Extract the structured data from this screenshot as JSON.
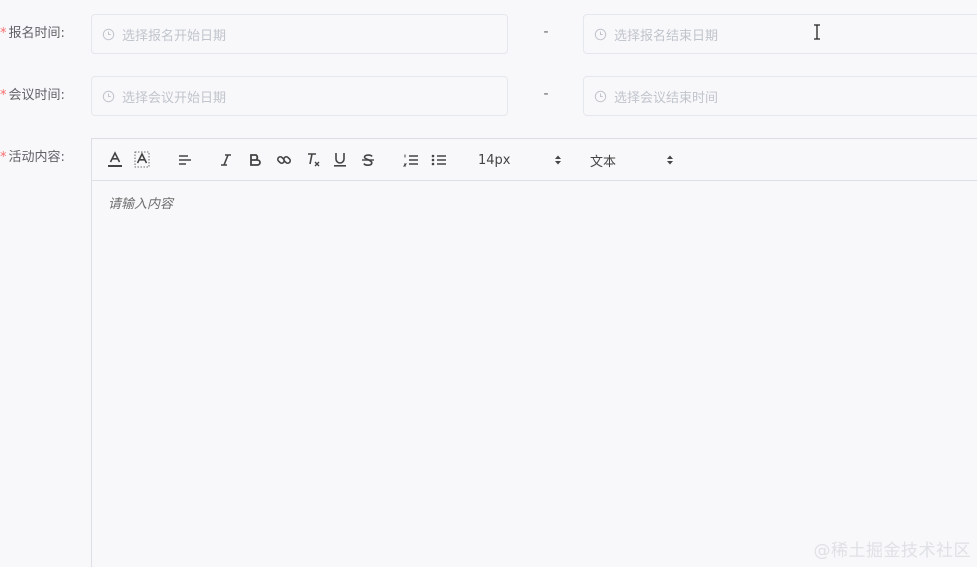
{
  "form": {
    "signup_time": {
      "label": "报名时间:",
      "start_placeholder": "选择报名开始日期",
      "end_placeholder": "选择报名结束日期",
      "separator": "-"
    },
    "meeting_time": {
      "label": "会议时间:",
      "start_placeholder": "选择会议开始日期",
      "end_placeholder": "选择会议结束时间",
      "separator": "-"
    },
    "activity_content": {
      "label": "活动内容:"
    },
    "required_mark": "*"
  },
  "editor": {
    "font_size": "14px",
    "header": "文本",
    "placeholder": "请输入内容",
    "toolbar_icons": [
      "font-color-icon",
      "background-color-icon",
      "align-icon",
      "italic-icon",
      "bold-icon",
      "link-icon",
      "clear-format-icon",
      "underline-icon",
      "strikethrough-icon",
      "ordered-list-icon",
      "bullet-list-icon"
    ]
  },
  "watermark": "@稀土掘金技术社区",
  "colors": {
    "required": "#f56c6c",
    "placeholder": "#c0c4cc",
    "label": "#606266",
    "border": "#e4e7ed"
  }
}
